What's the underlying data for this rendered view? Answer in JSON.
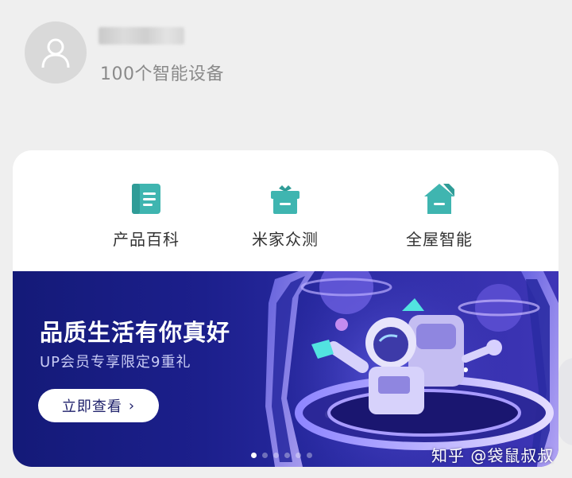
{
  "profile": {
    "device_count": "100个智能设备"
  },
  "quick_actions": [
    {
      "label": "产品百科",
      "icon": "book-icon",
      "color": "#3fb5b0"
    },
    {
      "label": "米家众测",
      "icon": "gift-box-icon",
      "color": "#3fb5b0"
    },
    {
      "label": "全屋智能",
      "icon": "house-icon",
      "color": "#3fb5b0"
    }
  ],
  "banner": {
    "title": "品质生活有你真好",
    "subtitle": "UP会员专享限定9重礼",
    "button_label": "立即查看",
    "button_chevron": "›",
    "page_count": 6,
    "active_page": 0,
    "background_color": "#1c1f8c"
  },
  "watermark": "知乎 @袋鼠叔叔"
}
